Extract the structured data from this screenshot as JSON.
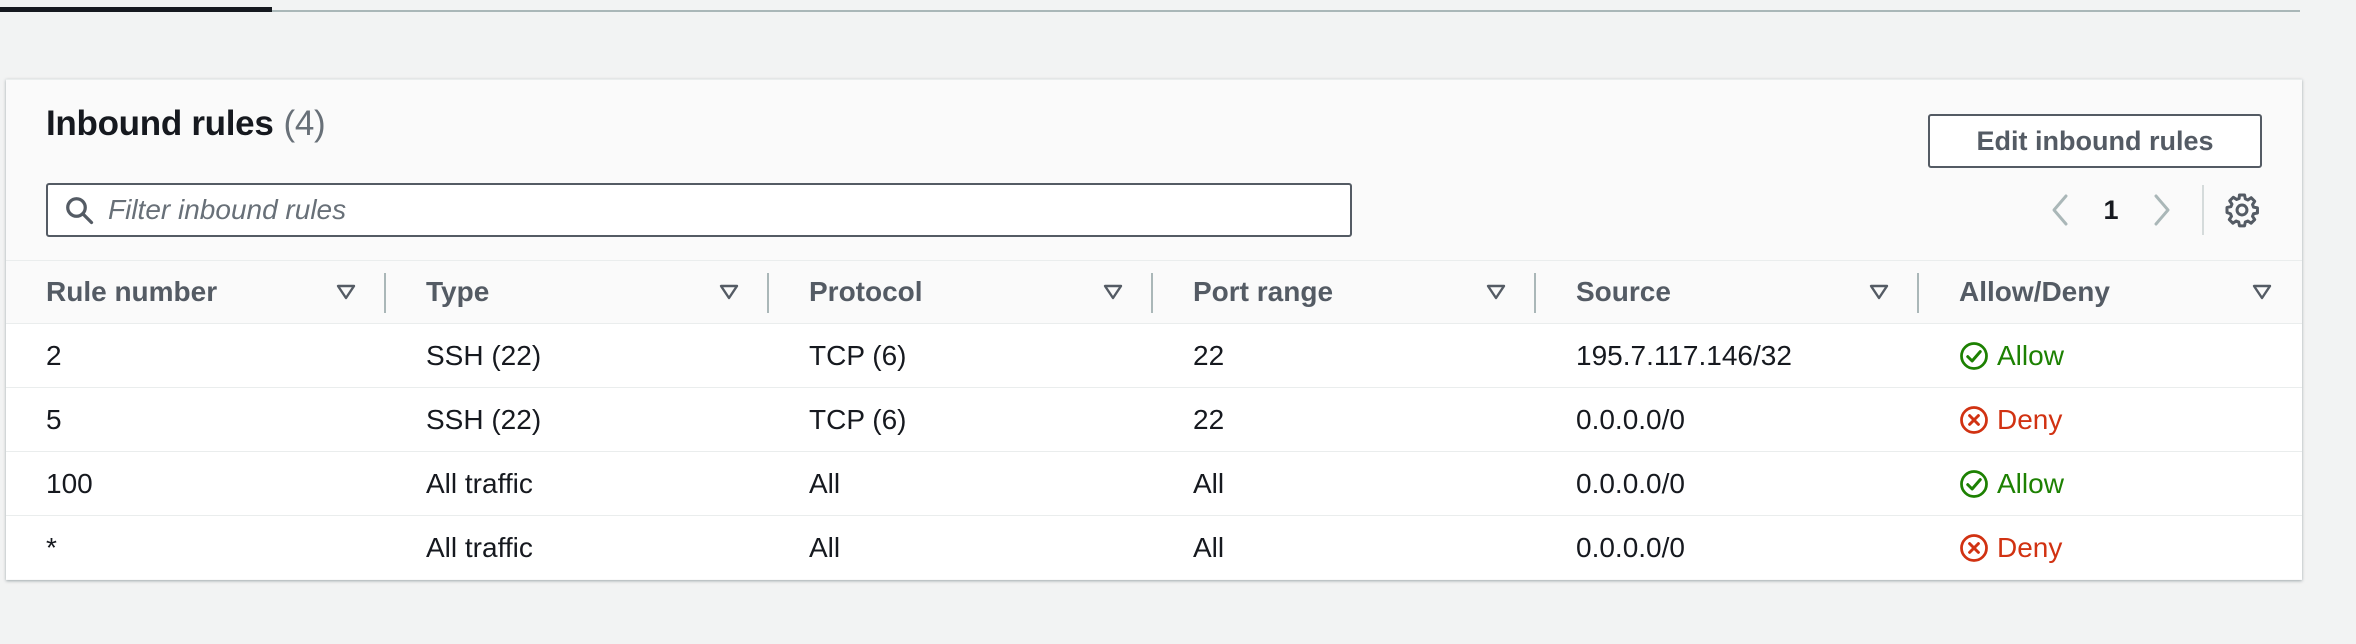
{
  "panel": {
    "title": "Inbound rules",
    "count": "(4)",
    "edit_button": "Edit inbound rules"
  },
  "filter": {
    "placeholder": "Filter inbound rules",
    "value": ""
  },
  "pager": {
    "current_page": "1"
  },
  "table": {
    "columns": [
      "Rule number",
      "Type",
      "Protocol",
      "Port range",
      "Source",
      "Allow/Deny"
    ],
    "rows": [
      {
        "rule_number": "2",
        "type": "SSH (22)",
        "protocol": "TCP (6)",
        "port_range": "22",
        "source": "195.7.117.146/32",
        "action": "Allow"
      },
      {
        "rule_number": "5",
        "type": "SSH (22)",
        "protocol": "TCP (6)",
        "port_range": "22",
        "source": "0.0.0.0/0",
        "action": "Deny"
      },
      {
        "rule_number": "100",
        "type": "All traffic",
        "protocol": "All",
        "port_range": "All",
        "source": "0.0.0.0/0",
        "action": "Allow"
      },
      {
        "rule_number": "*",
        "type": "All traffic",
        "protocol": "All",
        "port_range": "All",
        "source": "0.0.0.0/0",
        "action": "Deny"
      }
    ]
  },
  "colors": {
    "allow": "#1d8102",
    "deny": "#d13212",
    "header_text": "#545b64"
  },
  "icons": {
    "search": "search-icon",
    "prev": "chevron-left-icon",
    "next": "chevron-right-icon",
    "settings": "gear-icon",
    "sort": "sort-caret-icon",
    "allow": "check-circle-icon",
    "deny": "x-circle-icon"
  }
}
